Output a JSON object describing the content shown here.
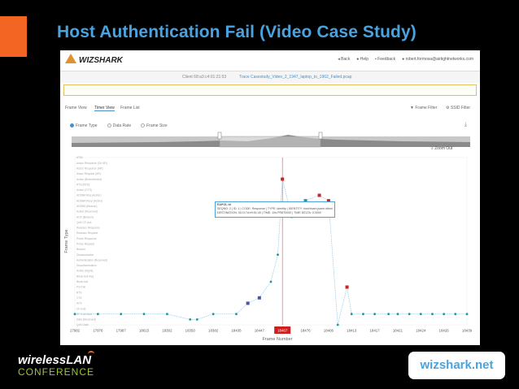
{
  "slide": {
    "title": "Host Authentication Fail (Video Case Study)",
    "footer_link": "wizshark.net",
    "footer_logo_line1_a": "wireless",
    "footer_logo_line1_b": "LAN",
    "footer_logo_line2": "CONFERENCE"
  },
  "app": {
    "logo": "WIZSHARK",
    "nav": [
      "Back",
      "Help",
      "Feedback",
      "robert.formosa@airtightnetworks.com"
    ],
    "client": "Client 68:a3:c4:01:21:53",
    "trace": "Trace Casestudy_Video_2_1947_laptop_to_1962_Failed.pcap",
    "tabs": [
      "Frame View",
      "Timer View",
      "Frame List"
    ],
    "tabs_right": [
      "Frame Filter",
      "SSID Filter"
    ],
    "radios": [
      "Frame Type",
      "Data Rate",
      "Frame Size"
    ],
    "zoom_out": "Zoom Out"
  },
  "tooltip": {
    "title": "EAPOL:Id",
    "line1": "SEQNO: 2 | ID: 1 | CODE: Response | TYPE: Identity | IDENTITY: host/ricam.jsane.rdbms.com | FLAGS: Acked",
    "line2": "DESTINATION: 00:1f:7d:e9:51:40 | TIME: 10s.PR8T0000 | TIME DELTA: 0.0000"
  },
  "chart_data": {
    "type": "scatter",
    "xlabel": "Frame Number",
    "ylabel": "Frame Type",
    "x_ticks": [
      "17982",
      "17976",
      "17987",
      "18015",
      "18302",
      "18350",
      "18382",
      "18435",
      "18447",
      "18467",
      "18476",
      "18406",
      "18413",
      "18417",
      "18421",
      "18424",
      "18426",
      "18439"
    ],
    "highlighted_tick": "18467",
    "y_categories": [
      "ATIM",
      "Assoc Response (On.AR)",
      "Assoc Response (AR)",
      "Assoc Request (AR)",
      "Action (Beamformed)",
      "RTS (RTS)",
      "Action (CTS)",
      "ADDBA Req (Action)",
      "ADDBA Resp (Action)",
      "ADDBA (Beacon)",
      "Action (Reserved)",
      "ACK (Beacon)",
      "QoS CF-Ack",
      "Reassoc Response",
      "Reassoc Request",
      "Probe Response",
      "Probe Request",
      "Beacon",
      "Disassociation",
      "Authentication (Reserved)",
      "Deauthentication",
      "Action (Mgmt)",
      "Block Ack Req",
      "Block Ack",
      "PS-Poll",
      "RTS",
      "CTS",
      "ACK",
      "CF-End",
      "CF-End+Ack",
      "Data (Reserved)",
      "QoS Data"
    ],
    "series": [
      {
        "name": "",
        "points": [
          [
            0,
            29
          ],
          [
            1,
            29
          ],
          [
            2,
            29
          ],
          [
            3,
            29
          ],
          [
            4,
            29
          ],
          [
            5,
            30
          ],
          [
            5.3,
            30
          ],
          [
            6,
            29
          ],
          [
            7,
            29
          ],
          [
            7.5,
            27
          ],
          [
            8,
            26
          ],
          [
            8.5,
            23
          ],
          [
            8.8,
            18
          ],
          [
            9,
            4
          ],
          [
            9.4,
            11
          ],
          [
            10,
            8
          ],
          [
            10.6,
            7
          ],
          [
            11,
            8
          ],
          [
            11.4,
            31
          ],
          [
            11.8,
            24
          ],
          [
            12,
            29
          ],
          [
            12.5,
            29
          ],
          [
            13,
            29
          ],
          [
            13.6,
            29
          ],
          [
            14,
            29
          ],
          [
            14.5,
            29
          ],
          [
            15,
            29
          ],
          [
            15.5,
            29
          ],
          [
            16,
            29
          ],
          [
            16.5,
            29
          ],
          [
            17,
            29
          ]
        ]
      }
    ],
    "markers": [
      {
        "x": 9,
        "y": 4,
        "color": "#cc2222"
      },
      {
        "x": 10.6,
        "y": 7,
        "color": "#cc2222"
      },
      {
        "x": 11,
        "y": 8,
        "color": "#cc2222"
      },
      {
        "x": 11.8,
        "y": 24,
        "color": "#cc2222"
      },
      {
        "x": 7.5,
        "y": 27,
        "color": "#4455aa"
      },
      {
        "x": 8,
        "y": 26,
        "color": "#4455aa"
      },
      {
        "x": 10,
        "y": 8,
        "color": "#1a9aa0"
      }
    ],
    "line_color": "#8fc8e8",
    "point_color": "#1a9aa0"
  }
}
